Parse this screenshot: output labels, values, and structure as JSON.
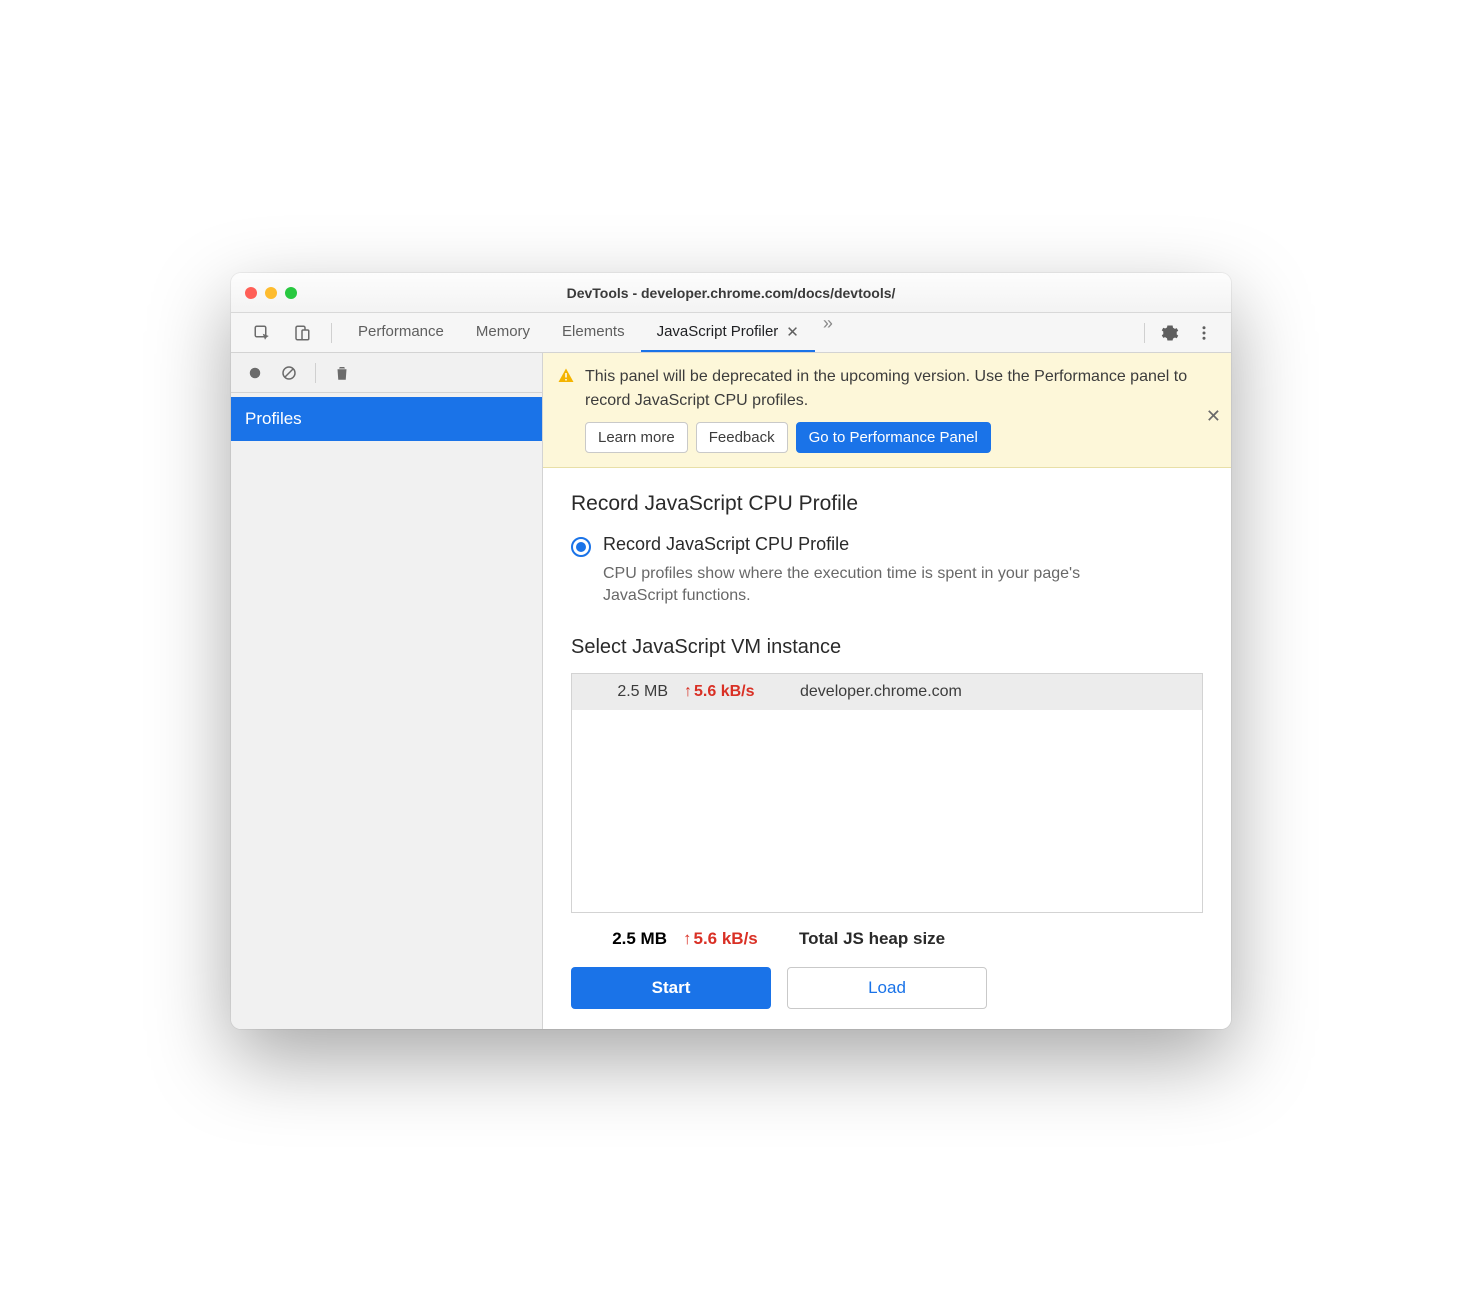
{
  "window": {
    "title": "DevTools - developer.chrome.com/docs/devtools/"
  },
  "tabs": {
    "items": [
      "Performance",
      "Memory",
      "Elements",
      "JavaScript Profiler"
    ],
    "activeIndex": 3
  },
  "sidebar": {
    "profiles_label": "Profiles"
  },
  "notice": {
    "text": "This panel will be deprecated in the upcoming version. Use the Performance panel to record JavaScript CPU profiles.",
    "learn_more": "Learn more",
    "feedback": "Feedback",
    "goto": "Go to Performance Panel"
  },
  "profile": {
    "heading": "Record JavaScript CPU Profile",
    "radio_label": "Record JavaScript CPU Profile",
    "radio_desc": "CPU profiles show where the execution time is spent in your page's JavaScript functions."
  },
  "vm": {
    "heading": "Select JavaScript VM instance",
    "row": {
      "size": "2.5 MB",
      "rate": "5.6 kB/s",
      "host": "developer.chrome.com"
    },
    "total": {
      "size": "2.5 MB",
      "rate": "5.6 kB/s",
      "label": "Total JS heap size"
    }
  },
  "actions": {
    "start": "Start",
    "load": "Load"
  }
}
